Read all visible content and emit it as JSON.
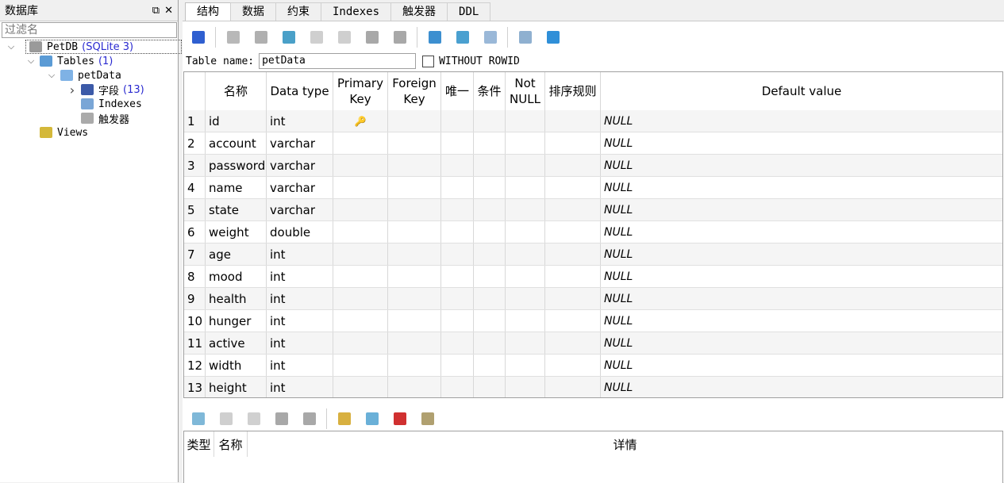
{
  "left_panel": {
    "title": "数据库",
    "filter_placeholder": "过滤名",
    "tree": [
      {
        "label": "PetDB",
        "count": "(SQLite 3)",
        "icon": "database-icon",
        "expanded": true,
        "level": 0
      },
      {
        "label": "Tables",
        "count": "(1)",
        "icon": "tables-icon",
        "expanded": true,
        "level": 1
      },
      {
        "label": "petData",
        "count": "",
        "icon": "table-icon",
        "expanded": true,
        "level": 2
      },
      {
        "label": "字段",
        "count": "(13)",
        "icon": "columns-icon",
        "expanded": false,
        "level": 3
      },
      {
        "label": "Indexes",
        "count": "",
        "icon": "indexes-icon",
        "level": 3
      },
      {
        "label": "触发器",
        "count": "",
        "icon": "triggers-icon",
        "level": 3
      },
      {
        "label": "Views",
        "count": "",
        "icon": "views-icon",
        "level": 1
      }
    ]
  },
  "tabs": [
    {
      "label": "结构",
      "active": true
    },
    {
      "label": "数据"
    },
    {
      "label": "约束"
    },
    {
      "label": "Indexes"
    },
    {
      "label": "触发器"
    },
    {
      "label": "DDL"
    }
  ],
  "table_name_label": "Table name:",
  "table_name": "petData",
  "without_rowid_label": "WITHOUT ROWID",
  "without_rowid_checked": false,
  "columns_headers": [
    "",
    "名称",
    "Data type",
    "Primary Key",
    "Foreign Key",
    "唯一",
    "条件",
    "Not NULL",
    "排序规则",
    "Default value"
  ],
  "columns": [
    {
      "n": "1",
      "name": "id",
      "type": "int",
      "pk": true,
      "default": "NULL"
    },
    {
      "n": "2",
      "name": "account",
      "type": "varchar",
      "default": "NULL"
    },
    {
      "n": "3",
      "name": "password",
      "type": "varchar",
      "default": "NULL"
    },
    {
      "n": "4",
      "name": "name",
      "type": "varchar",
      "default": "NULL"
    },
    {
      "n": "5",
      "name": "state",
      "type": "varchar",
      "default": "NULL"
    },
    {
      "n": "6",
      "name": "weight",
      "type": "double",
      "default": "NULL"
    },
    {
      "n": "7",
      "name": "age",
      "type": "int",
      "default": "NULL"
    },
    {
      "n": "8",
      "name": "mood",
      "type": "int",
      "default": "NULL"
    },
    {
      "n": "9",
      "name": "health",
      "type": "int",
      "default": "NULL"
    },
    {
      "n": "10",
      "name": "hunger",
      "type": "int",
      "default": "NULL"
    },
    {
      "n": "11",
      "name": "active",
      "type": "int",
      "default": "NULL"
    },
    {
      "n": "12",
      "name": "width",
      "type": "int",
      "default": "NULL"
    },
    {
      "n": "13",
      "name": "height",
      "type": "int",
      "default": "NULL"
    }
  ],
  "constraints_headers": [
    "类型",
    "名称",
    "详情"
  ]
}
